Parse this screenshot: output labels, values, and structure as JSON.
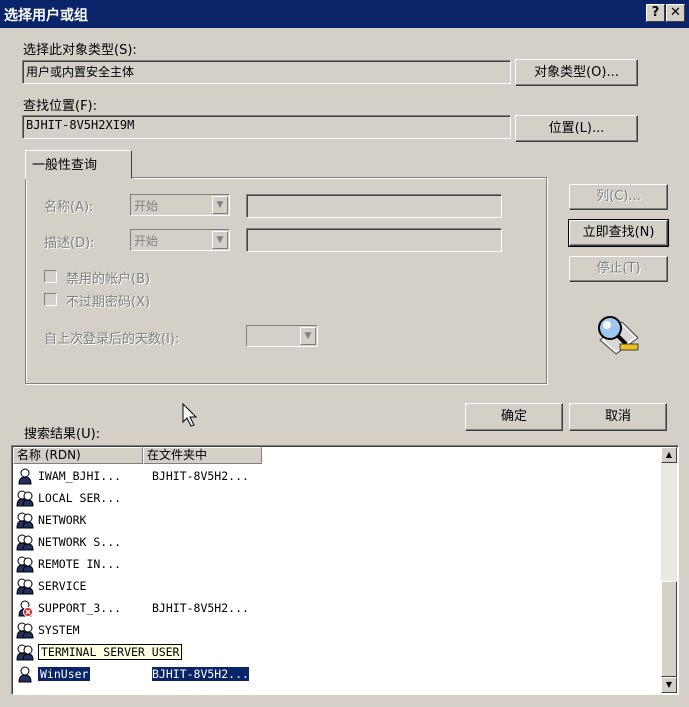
{
  "window": {
    "title": "选择用户或组",
    "help_label": "?",
    "close_label": "✕"
  },
  "object_type": {
    "label": "选择此对象类型(S):",
    "value": "用户或内置安全主体",
    "button": "对象类型(O)..."
  },
  "location": {
    "label": "查找位置(F):",
    "value": "BJHIT-8V5H2XI9M",
    "button": "位置(L)..."
  },
  "query": {
    "tab_label": "一般性查询",
    "name_label": "名称(A):",
    "name_mode": "开始",
    "desc_label": "描述(D):",
    "desc_mode": "开始",
    "disabled_accounts_label": "禁用的帐户(B)",
    "nonexpiring_pw_label": "不过期密码(X)",
    "days_label": "自上次登录后的天数(I):"
  },
  "side_buttons": {
    "columns": "列(C)...",
    "find_now": "立即查找(N)",
    "stop": "停止(T)"
  },
  "dialog_buttons": {
    "ok": "确定",
    "cancel": "取消"
  },
  "results": {
    "label": "搜索结果(U):",
    "columns": [
      "名称 (RDN)",
      "在文件夹中"
    ],
    "rows": [
      {
        "name": "IWAM_BJHI...",
        "folder": "BJHIT-8V5H2...",
        "icon": "user-icon"
      },
      {
        "name": "LOCAL SER...",
        "folder": "",
        "icon": "group-icon"
      },
      {
        "name": "NETWORK",
        "folder": "",
        "icon": "group-icon"
      },
      {
        "name": "NETWORK S...",
        "folder": "",
        "icon": "group-icon"
      },
      {
        "name": "REMOTE IN...",
        "folder": "",
        "icon": "group-icon"
      },
      {
        "name": "SERVICE",
        "folder": "",
        "icon": "group-icon"
      },
      {
        "name": "SUPPORT_3...",
        "folder": "BJHIT-8V5H2...",
        "icon": "disabled-user-icon"
      },
      {
        "name": "SYSTEM",
        "folder": "",
        "icon": "group-icon"
      },
      {
        "name": "TERMINAL SERVER USER",
        "folder": "",
        "icon": "group-icon"
      },
      {
        "name": "WinUser",
        "folder": "BJHIT-8V5H2...",
        "icon": "user-icon",
        "selected": true
      }
    ]
  }
}
